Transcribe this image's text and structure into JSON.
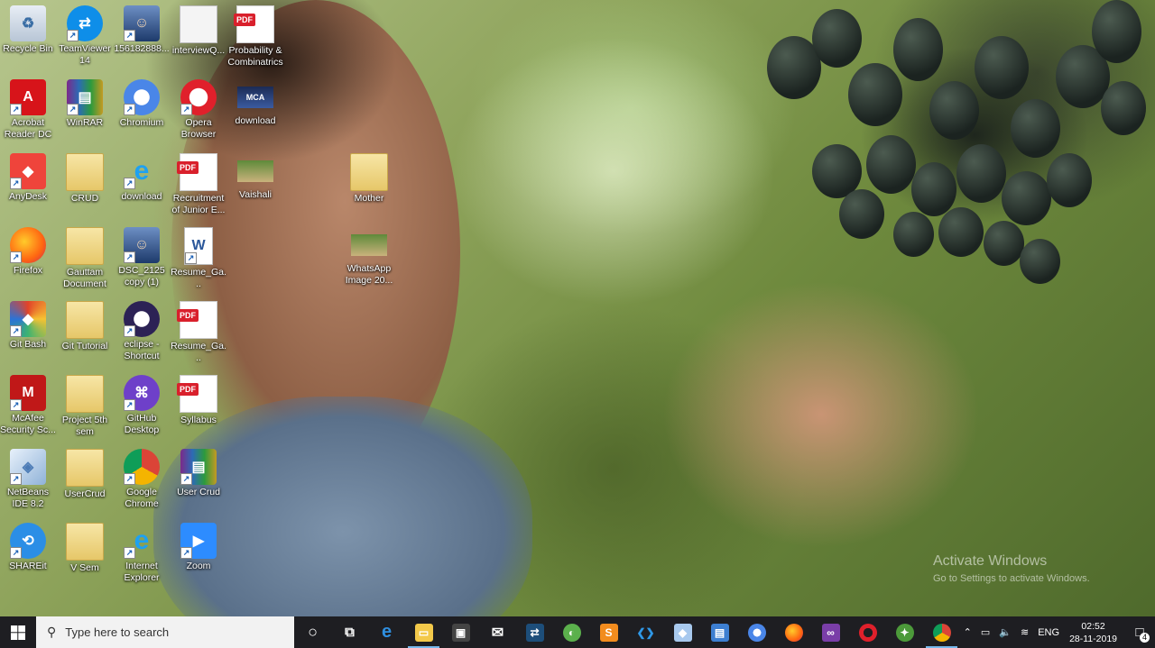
{
  "desktop": {
    "icons": [
      {
        "label": "Recycle Bin",
        "icon": "recycle-bin-icon"
      },
      {
        "label": "TeamViewer 14",
        "icon": "teamviewer-icon"
      },
      {
        "label": "156182888...",
        "icon": "photo-icon"
      },
      {
        "label": "interviewQ...",
        "icon": "document-icon"
      },
      {
        "label": "Probability & Combinatrics",
        "icon": "pdf-icon"
      },
      {
        "label": "Acrobat Reader DC",
        "icon": "acrobat-icon"
      },
      {
        "label": "WinRAR",
        "icon": "winrar-icon"
      },
      {
        "label": "Chromium",
        "icon": "chromium-icon"
      },
      {
        "label": "Opera Browser",
        "icon": "opera-icon"
      },
      {
        "label": "download",
        "icon": "mca-image-icon"
      },
      {
        "label": "AnyDesk",
        "icon": "anydesk-icon"
      },
      {
        "label": "CRUD",
        "icon": "folder-icon"
      },
      {
        "label": "download",
        "icon": "internet-explorer-icon"
      },
      {
        "label": "Recruitment of Junior E...",
        "icon": "pdf-icon"
      },
      {
        "label": "Vaishali",
        "icon": "image-icon"
      },
      {
        "label": "Mother",
        "icon": "folder-icon"
      },
      {
        "label": "Firefox",
        "icon": "firefox-icon"
      },
      {
        "label": "Gauttam Document",
        "icon": "folder-icon"
      },
      {
        "label": "DSC_2125 copy (1)",
        "icon": "photo-icon"
      },
      {
        "label": "Resume_Ga...",
        "icon": "word-icon"
      },
      {
        "label": "WhatsApp Image 20...",
        "icon": "image-icon"
      },
      {
        "label": "Git Bash",
        "icon": "git-bash-icon"
      },
      {
        "label": "Git Tutorial",
        "icon": "folder-icon"
      },
      {
        "label": "eclipse - Shortcut",
        "icon": "eclipse-icon"
      },
      {
        "label": "Resume_Ga...",
        "icon": "pdf-icon"
      },
      {
        "label": "McAfee Security Sc...",
        "icon": "mcafee-icon"
      },
      {
        "label": "Project 5th sem",
        "icon": "folder-icon"
      },
      {
        "label": "GitHub Desktop",
        "icon": "github-icon"
      },
      {
        "label": "Syllabus",
        "icon": "pdf-icon"
      },
      {
        "label": "NetBeans IDE 8.2",
        "icon": "netbeans-icon"
      },
      {
        "label": "UserCrud",
        "icon": "folder-icon"
      },
      {
        "label": "Google Chrome",
        "icon": "chrome-icon"
      },
      {
        "label": "User Crud",
        "icon": "winrar-icon"
      },
      {
        "label": "SHAREit",
        "icon": "shareit-icon"
      },
      {
        "label": "V Sem",
        "icon": "folder-icon"
      },
      {
        "label": "Internet Explorer",
        "icon": "internet-explorer-icon"
      },
      {
        "label": "Zoom",
        "icon": "zoom-icon"
      }
    ]
  },
  "watermark": {
    "line1": "Activate Windows",
    "line2": "Go to Settings to activate Windows."
  },
  "taskbar": {
    "search_placeholder": "Type here to search",
    "pinned": [
      "cortana-icon",
      "task-view-icon",
      "edge-icon",
      "file-explorer-icon",
      "store-icon",
      "mail-icon",
      "teamviewer-task-icon",
      "greenshot-icon",
      "sublime-icon",
      "vscode-icon",
      "virtualbox-icon",
      "remote-icon",
      "chromium-icon",
      "firefox-icon",
      "visual-studio-icon",
      "opera-icon",
      "android-icon",
      "chrome-icon"
    ],
    "language": "ENG",
    "time": "02:52",
    "date": "28-11-2019",
    "notification_count": "4"
  },
  "colors": {
    "taskbar": "#1e1e22",
    "search_bg": "#f2f2f2",
    "active_indicator": "#76b9ed"
  }
}
